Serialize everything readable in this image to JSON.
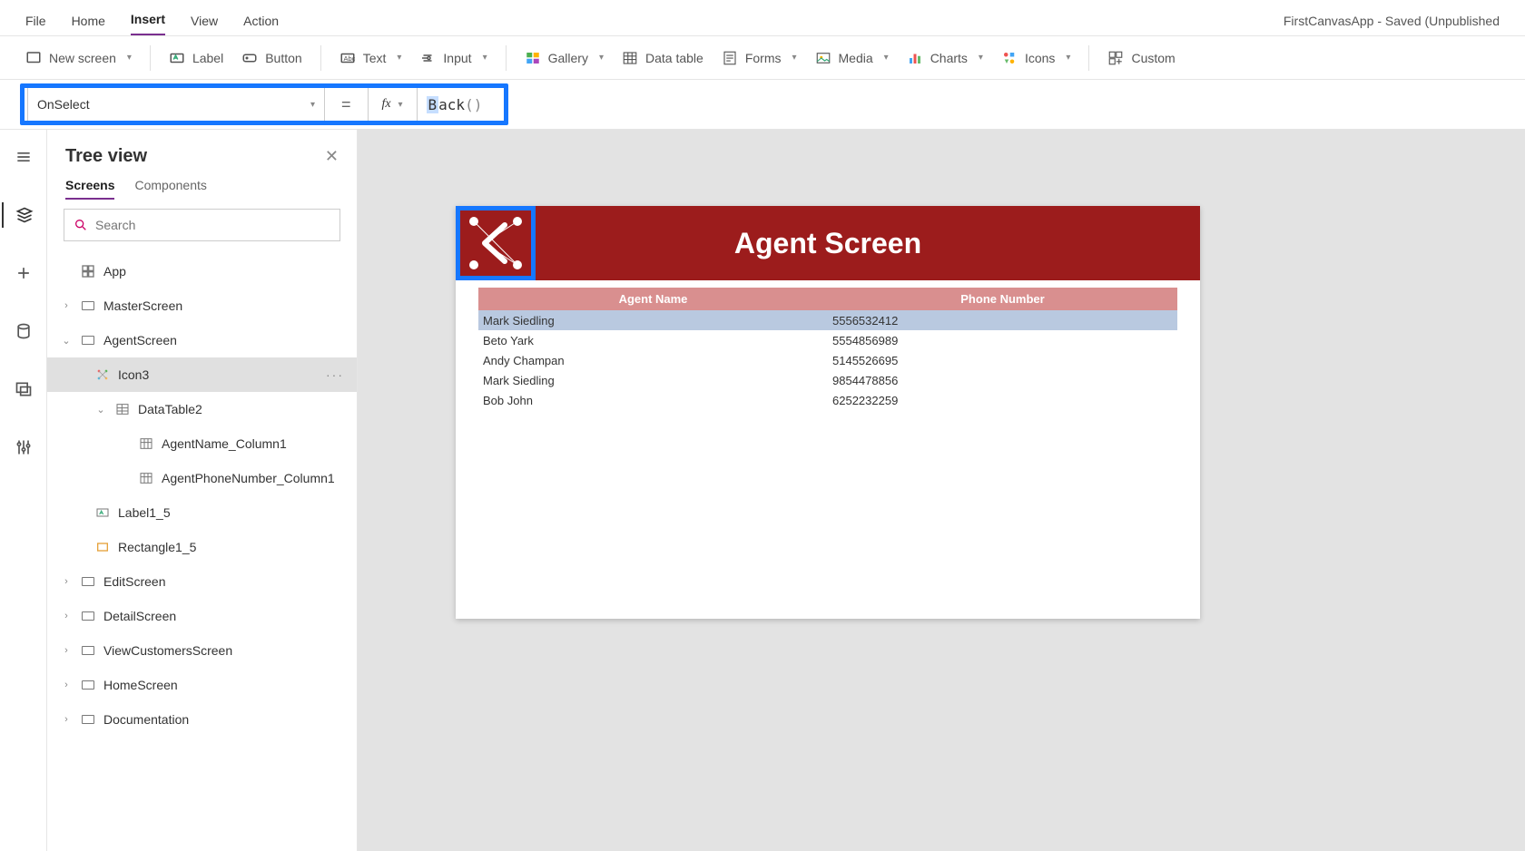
{
  "menu": {
    "items": [
      "File",
      "Home",
      "Insert",
      "View",
      "Action"
    ],
    "active": "Insert"
  },
  "app_status": "FirstCanvasApp - Saved (Unpublished",
  "ribbon": {
    "new_screen": "New screen",
    "label": "Label",
    "button": "Button",
    "text": "Text",
    "input": "Input",
    "gallery": "Gallery",
    "data_table": "Data table",
    "forms": "Forms",
    "media": "Media",
    "charts": "Charts",
    "icons": "Icons",
    "custom": "Custom"
  },
  "formula": {
    "property": "OnSelect",
    "equals": "=",
    "expr_prefix": "B",
    "expr_mid": "ack",
    "expr_paren": "()"
  },
  "treeview": {
    "title": "Tree view",
    "tabs": {
      "screens": "Screens",
      "components": "Components"
    },
    "search_placeholder": "Search",
    "app": "App",
    "nodes": {
      "master": "MasterScreen",
      "agent": "AgentScreen",
      "icon3": "Icon3",
      "datatable2": "DataTable2",
      "col_name": "AgentName_Column1",
      "col_phone": "AgentPhoneNumber_Column1",
      "label1_5": "Label1_5",
      "rect1_5": "Rectangle1_5",
      "edit": "EditScreen",
      "detail": "DetailScreen",
      "viewcust": "ViewCustomersScreen",
      "home": "HomeScreen",
      "docs": "Documentation"
    }
  },
  "screen": {
    "title": "Agent Screen",
    "headers": {
      "name": "Agent Name",
      "phone": "Phone Number"
    },
    "rows": [
      {
        "name": "Mark Siedling",
        "phone": "5556532412"
      },
      {
        "name": "Beto Yark",
        "phone": "5554856989"
      },
      {
        "name": "Andy Champan",
        "phone": "5145526695"
      },
      {
        "name": "Mark Siedling",
        "phone": "9854478856"
      },
      {
        "name": "Bob John",
        "phone": "6252232259"
      }
    ]
  }
}
